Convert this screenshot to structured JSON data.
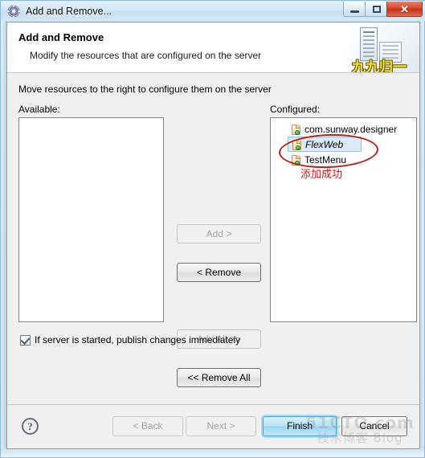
{
  "window": {
    "title": "Add and Remove...",
    "icon": "gear-icon",
    "controls": {
      "minimize": "–",
      "maximize": "□",
      "close": "✕"
    }
  },
  "banner": {
    "title": "Add and Remove",
    "description": "Modify the resources that are configured on the server",
    "watermark": "九九归一",
    "image": "server-tower-icon"
  },
  "body": {
    "instruction": "Move resources to the right to configure them on the server",
    "available": {
      "label": "Available:",
      "items": []
    },
    "configured": {
      "label": "Configured:",
      "items": [
        {
          "label": "com.sunway.designer",
          "selected": false
        },
        {
          "label": "FlexWeb",
          "selected": true
        },
        {
          "label": "TestMenu",
          "selected": false
        }
      ],
      "annotation": "添加成功",
      "annotation_color": "#d81515",
      "ellipse_color": "#b32418"
    },
    "transfer_buttons": [
      {
        "label": "Add >",
        "enabled": false
      },
      {
        "label": "< Remove",
        "enabled": true
      },
      {
        "label": "Add All >>",
        "enabled": false
      },
      {
        "label": "<< Remove All",
        "enabled": true
      }
    ],
    "publish_checkbox": {
      "label": "If server is started, publish changes immediately",
      "checked": true
    }
  },
  "footer": {
    "help": "?",
    "buttons": [
      {
        "label": "< Back",
        "state": "disabled"
      },
      {
        "label": "Next >",
        "state": "disabled"
      },
      {
        "label": "Finish",
        "state": "default"
      },
      {
        "label": "Cancel",
        "state": "enabled"
      }
    ]
  },
  "watermark": {
    "line1": "51CTO.com",
    "line2": "技术博客  Blog"
  }
}
